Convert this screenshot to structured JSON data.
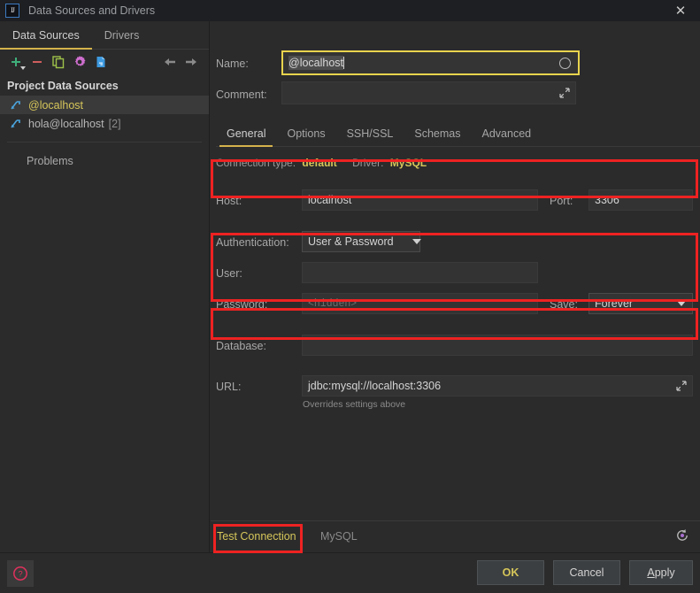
{
  "window": {
    "title": "Data Sources and Drivers",
    "logo_icon": "intellij-idea-logo",
    "close_icon": "close-icon",
    "close_glyph": "✕"
  },
  "sidebar": {
    "tabs": [
      {
        "label": "Data Sources",
        "active": true
      },
      {
        "label": "Drivers",
        "active": false
      }
    ],
    "toolbar": [
      {
        "name": "add-button",
        "icon": "plus-icon",
        "color": "#3fae7a"
      },
      {
        "name": "remove-button",
        "icon": "minus-icon",
        "color": "#cf5d5d"
      },
      {
        "name": "duplicate-button",
        "icon": "copy-icon",
        "color": "#9ec24a"
      },
      {
        "name": "properties-button",
        "icon": "gear-icon",
        "color": "#d06fd0"
      },
      {
        "name": "import-button",
        "icon": "file-icon",
        "color": "#3d9ae0"
      },
      {
        "name": "back-button",
        "icon": "arrow-left-icon",
        "color": "#8a8a8a"
      },
      {
        "name": "forward-button",
        "icon": "arrow-right-icon",
        "color": "#8a8a8a"
      }
    ],
    "section_title": "Project Data Sources",
    "items": [
      {
        "label": "@localhost",
        "count": "",
        "selected": true,
        "icon": "datasource-icon"
      },
      {
        "label": "hola@localhost",
        "count": "[2]",
        "selected": false,
        "icon": "datasource-icon"
      }
    ],
    "problems_label": "Problems"
  },
  "form": {
    "name": {
      "label": "Name:",
      "value": "@localhost",
      "highlighted": true,
      "status_icon": "circle-icon"
    },
    "comment": {
      "label": "Comment:",
      "value": "",
      "expand_icon": "expand-icon"
    },
    "tabs": [
      {
        "label": "General",
        "active": true
      },
      {
        "label": "Options",
        "active": false
      },
      {
        "label": "SSH/SSL",
        "active": false
      },
      {
        "label": "Schemas",
        "active": false
      },
      {
        "label": "Advanced",
        "active": false
      }
    ],
    "connection_type_label": "Connection type:",
    "connection_type_value": "default",
    "driver_label": "Driver:",
    "driver_value": "MySQL",
    "host": {
      "label": "Host:",
      "value": "localhost"
    },
    "port": {
      "label": "Port:",
      "value": "3306"
    },
    "authentication": {
      "label": "Authentication:",
      "value": "User & Password",
      "dropdown_icon": "chevron-down-icon"
    },
    "user": {
      "label": "User:",
      "value": ""
    },
    "password": {
      "label": "Password:",
      "value": "",
      "placeholder": "<hidden>"
    },
    "save": {
      "label": "Save:",
      "value": "Forever",
      "dropdown_icon": "chevron-down-icon"
    },
    "database": {
      "label": "Database:",
      "value": ""
    },
    "url": {
      "label": "URL:",
      "value": "jdbc:mysql://localhost:3306",
      "hint": "Overrides settings above",
      "expand_icon": "expand-icon"
    }
  },
  "bottom": {
    "test_connection_label": "Test Connection",
    "driver_name": "MySQL",
    "revert_icon": "revert-icon"
  },
  "footer": {
    "help_icon": "help-icon",
    "help_glyph": "?",
    "buttons": [
      {
        "name": "ok-button",
        "label": "OK"
      },
      {
        "name": "cancel-button",
        "label": "Cancel"
      },
      {
        "name": "apply-button",
        "label": "Apply"
      }
    ]
  },
  "annotations": {
    "color": "#ee2222",
    "boxes": [
      "host-port-row",
      "user-password-row",
      "database-row",
      "test-connection-button"
    ]
  }
}
